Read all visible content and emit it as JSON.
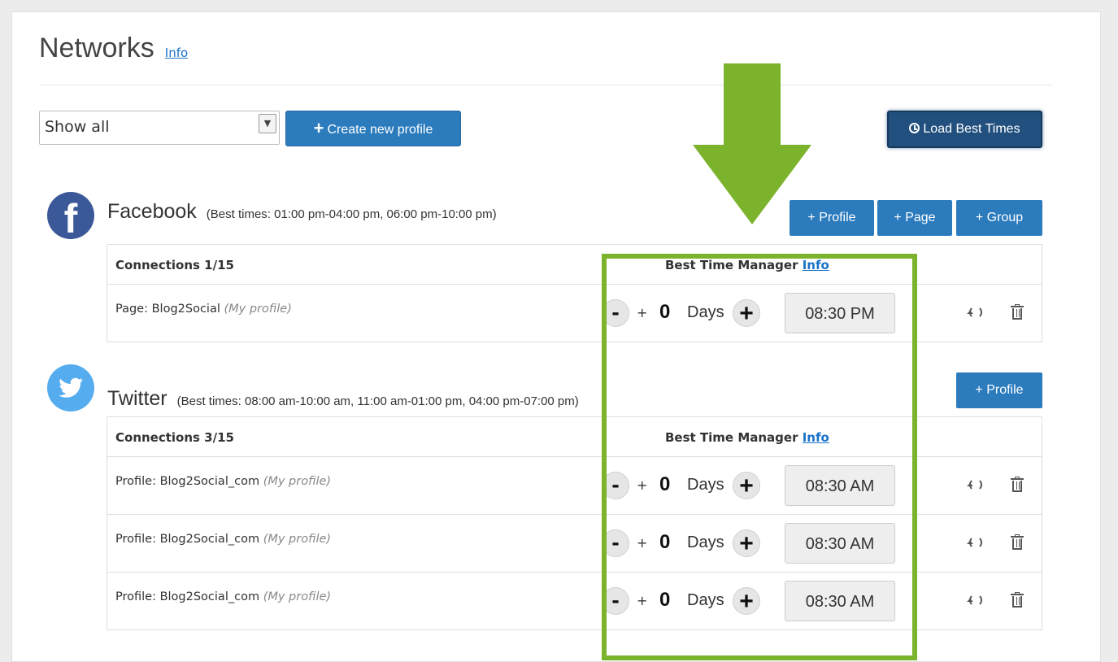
{
  "page": {
    "title": "Networks",
    "info_link": "Info"
  },
  "toolbar": {
    "filter_value": "Show all",
    "create_profile_label": "Create new profile",
    "load_best_times_label": "Load Best Times"
  },
  "facebook": {
    "name": "Facebook",
    "best_times": "(Best times: 01:00 pm-04:00 pm, 06:00 pm-10:00 pm)",
    "buttons": [
      "+ Profile",
      "+ Page",
      "+ Group"
    ],
    "connections_header": "Connections 1/15",
    "btm_header": "Best Time Manager",
    "btm_info": "Info",
    "rows": [
      {
        "type": "Page: Blog2Social",
        "tag": "(My profile)",
        "days": "0",
        "days_label": "Days",
        "time": "08:30 PM"
      }
    ]
  },
  "twitter": {
    "name": "Twitter",
    "best_times": "(Best times: 08:00 am-10:00 am, 11:00 am-01:00 pm, 04:00 pm-07:00 pm)",
    "buttons": [
      "+ Profile"
    ],
    "connections_header": "Connections 3/15",
    "btm_header": "Best Time Manager",
    "btm_info": "Info",
    "rows": [
      {
        "type": "Profile: Blog2Social_com",
        "tag": "(My profile)",
        "days": "0",
        "days_label": "Days",
        "time": "08:30 AM"
      },
      {
        "type": "Profile: Blog2Social_com",
        "tag": "(My profile)",
        "days": "0",
        "days_label": "Days",
        "time": "08:30 AM"
      },
      {
        "type": "Profile: Blog2Social_com",
        "tag": "(My profile)",
        "days": "0",
        "days_label": "Days",
        "time": "08:30 AM"
      }
    ]
  },
  "stepper": {
    "minus": "-",
    "small_plus": "+",
    "plus": "+"
  },
  "colors": {
    "primary": "#2b7bbd",
    "dark_button": "#22507e",
    "highlight": "#7cb32c",
    "facebook": "#3b5998",
    "twitter": "#55acee"
  }
}
